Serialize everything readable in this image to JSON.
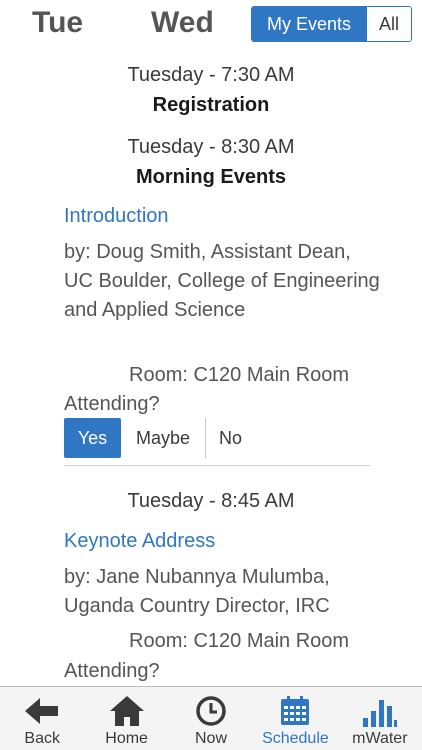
{
  "header": {
    "day_tue": "Tue",
    "day_wed": "Wed",
    "filter_my_events": "My Events",
    "filter_all": "All"
  },
  "schedule": {
    "block1": {
      "time": "Tuesday - 7:30 AM",
      "title": "Registration"
    },
    "block2": {
      "time": "Tuesday - 8:30 AM",
      "title": "Morning Events",
      "event": {
        "title": "Introduction",
        "by": "by: Doug Smith, Assistant Dean, UC Boulder, College of Engineering and Applied Science",
        "room": "Room: C120 Main Room",
        "attending_label": "Attending?",
        "rsvp": {
          "yes": "Yes",
          "maybe": "Maybe",
          "no": "No",
          "selected": "Yes"
        }
      }
    },
    "block3": {
      "time": "Tuesday - 8:45 AM",
      "event": {
        "title": "Keynote Address",
        "by": "by: Jane Nubannya Mulumba, Uganda Country Director, IRC",
        "room": "Room: C120 Main Room",
        "attending_label": "Attending?"
      }
    }
  },
  "tabbar": {
    "items": [
      {
        "label": "Back",
        "icon": "arrow-left-icon"
      },
      {
        "label": "Home",
        "icon": "home-icon"
      },
      {
        "label": "Now",
        "icon": "clock-icon"
      },
      {
        "label": "Schedule",
        "icon": "calendar-icon",
        "active": true
      },
      {
        "label": "mWater",
        "icon": "bar-chart-icon"
      }
    ],
    "colors": {
      "accent": "#2f77c3",
      "icon": "#3a3a3a"
    }
  }
}
